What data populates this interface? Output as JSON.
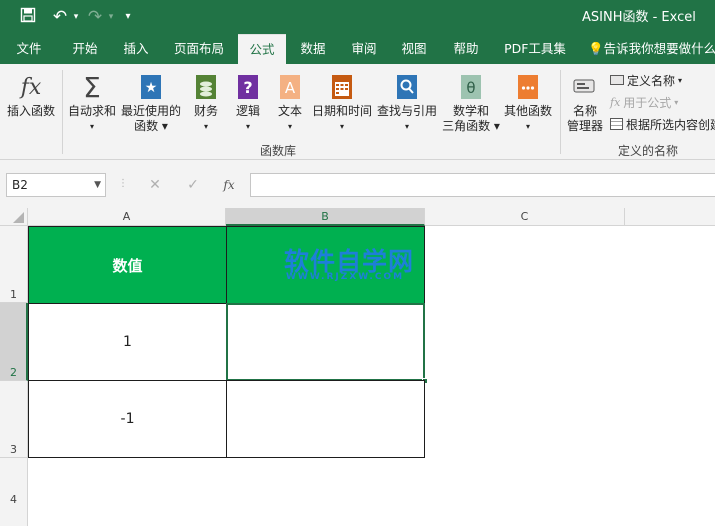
{
  "window": {
    "title": "ASINH函数 - Excel"
  },
  "quick_access": {
    "undo_label": "↶",
    "redo_label": "↷",
    "customize_label": "▾"
  },
  "tabs": [
    {
      "label": "文件"
    },
    {
      "label": "开始"
    },
    {
      "label": "插入"
    },
    {
      "label": "页面布局"
    },
    {
      "label": "公式"
    },
    {
      "label": "数据"
    },
    {
      "label": "审阅"
    },
    {
      "label": "视图"
    },
    {
      "label": "帮助"
    },
    {
      "label": "PDF工具集"
    }
  ],
  "tell_me": "告诉我你想要做什么",
  "ribbon": {
    "insert_function": "插入函数",
    "autosum": "自动求和",
    "recent_line1": "最近使用的",
    "recent_line2": "函数",
    "financial": "财务",
    "logical": "逻辑",
    "text": "文本",
    "datetime": "日期和时间",
    "lookup": "查找与引用",
    "math_line1": "数学和",
    "math_line2": "三角函数",
    "more": "其他函数",
    "group_library": "函数库",
    "name_manager_line1": "名称",
    "name_manager_line2": "管理器",
    "define_name": "定义名称",
    "use_in_formula": "用于公式",
    "create_from_selection": "根据所选内容创建",
    "group_names": "定义的名称"
  },
  "formula_bar": {
    "name_box": "B2",
    "cancel": "✕",
    "enter": "✓",
    "fx": "fx",
    "value": ""
  },
  "grid": {
    "columns": [
      "A",
      "B",
      "C"
    ],
    "rows": [
      "1",
      "2",
      "3",
      "4"
    ],
    "cells": {
      "A1": "数值",
      "B1": "",
      "A2": "1",
      "B2": "",
      "A3": "-1",
      "B3": ""
    }
  },
  "watermark": {
    "main": "软件自学网",
    "sub": "WWW.RJZXW.COM"
  },
  "colors": {
    "brand": "#217346",
    "header_fill": "#00b050"
  }
}
